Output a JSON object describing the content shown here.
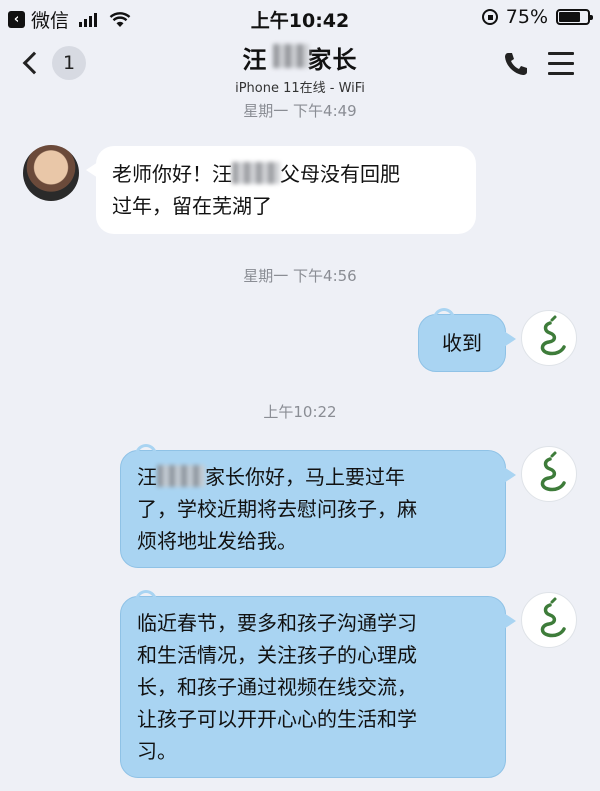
{
  "status_bar": {
    "carrier": "微信",
    "time": "上午10:42",
    "battery": "75%",
    "battery_level": 0.75
  },
  "header": {
    "back_count": "1",
    "name_prefix": "汪",
    "name_suffix": "家长",
    "subtitle": "iPhone 11在线 - WiFi"
  },
  "messages": [
    {
      "type": "timestamp",
      "text": "星期一 下午4:49"
    },
    {
      "type": "incoming",
      "text_a": "老师你好！汪",
      "text_b": "父母没有回肥",
      "text_c": "过年，留在芜湖了"
    },
    {
      "type": "timestamp",
      "text": "星期一 下午4:56"
    },
    {
      "type": "outgoing",
      "text": "收到"
    },
    {
      "type": "timestamp",
      "text": "上午10:22"
    },
    {
      "type": "outgoing",
      "text_a": "汪",
      "text_b": "家长你好，马上要过年",
      "text_c": "了，学校近期将去慰问孩子，麻",
      "text_d": "烦将地址发给我。"
    },
    {
      "type": "outgoing",
      "line1": "临近春节，要多和孩子沟通学习",
      "line2": "和生活情况，关注孩子的心理成",
      "line3": "长，和孩子通过视频在线交流，",
      "line4": "让孩子可以开开心心的生活和学",
      "line5": "习。"
    }
  ],
  "colors": {
    "background": "#eef0f6",
    "outgoing_bubble": "#a9d4f2",
    "incoming_bubble": "#ffffff"
  },
  "icons": {
    "phone": "phone-icon",
    "menu": "hamburger-menu-icon",
    "back": "chevron-left-icon"
  }
}
